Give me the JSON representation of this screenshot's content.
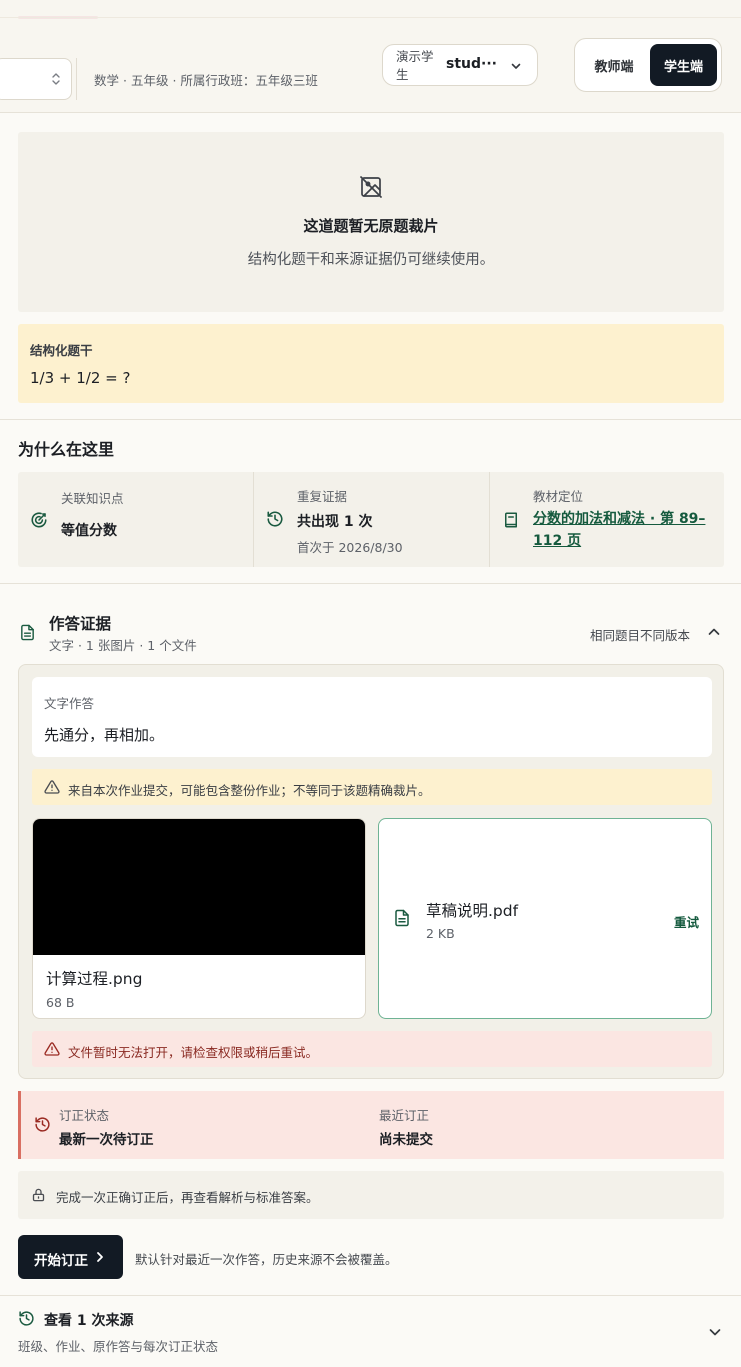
{
  "header": {
    "meta": {
      "subject": "数学",
      "grade": "五年级",
      "class_label": "所属行政班：",
      "class_value": "五年级三班"
    },
    "student_select": {
      "label": "演示学生",
      "value": "stud···"
    },
    "role_toggle": {
      "teacher": "教师端",
      "student": "学生端",
      "active": "student"
    }
  },
  "question_image": {
    "title": "这道题暂无原题裁片",
    "subtitle": "结构化题干和来源证据仍可继续使用。",
    "icon": "image-off-icon"
  },
  "stem": {
    "label": "结构化题干",
    "content": "1/3 + 1/2 = ?"
  },
  "why_here": {
    "title": "为什么在这里",
    "knowledge": {
      "caption": "关联知识点",
      "value": "等值分数",
      "icon": "target-icon"
    },
    "repeat": {
      "caption": "重复证据",
      "value": "共出现 1 次",
      "note": "首次于 2026/8/30",
      "icon": "history-icon"
    },
    "textbook": {
      "caption": "教材定位",
      "link": "分数的加法和减法 · 第 89–112 页",
      "icon": "book-icon"
    }
  },
  "evidence": {
    "title": "作答证据",
    "subtitle": "文字 · 1 张图片 · 1 个文件",
    "version_link": "相同题目不同版本",
    "text_answer": {
      "label": "文字作答",
      "content": "先通分，再相加。"
    },
    "warning": "来自本次作业提交，可能包含整份作业；不等同于该题精确裁片。",
    "image_file": {
      "name": "计算过程.png",
      "size": "68 B"
    },
    "pdf_file": {
      "name": "草稿说明.pdf",
      "size": "2 KB",
      "retry": "重试"
    },
    "error": "文件暂时无法打开，请检查权限或稍后重试。"
  },
  "correction": {
    "status_caption": "订正状态",
    "status_value": "最新一次待订正",
    "recent_caption": "最近订正",
    "recent_value": "尚未提交"
  },
  "lock_notice": "完成一次正确订正后，再查看解析与标准答案。",
  "start": {
    "label": "开始订正",
    "note": "默认针对最近一次作答，历史来源不会被覆盖。"
  },
  "sources": {
    "title": "查看 1 次来源",
    "subtitle": "班级、作业、原作答与每次订正状态"
  },
  "colors": {
    "accent_green": "#155a3e",
    "dark_button": "#121a24",
    "warn_bg": "#fdf1cf",
    "error_bg": "#fbe6e2",
    "error_bar": "#d96f62"
  }
}
